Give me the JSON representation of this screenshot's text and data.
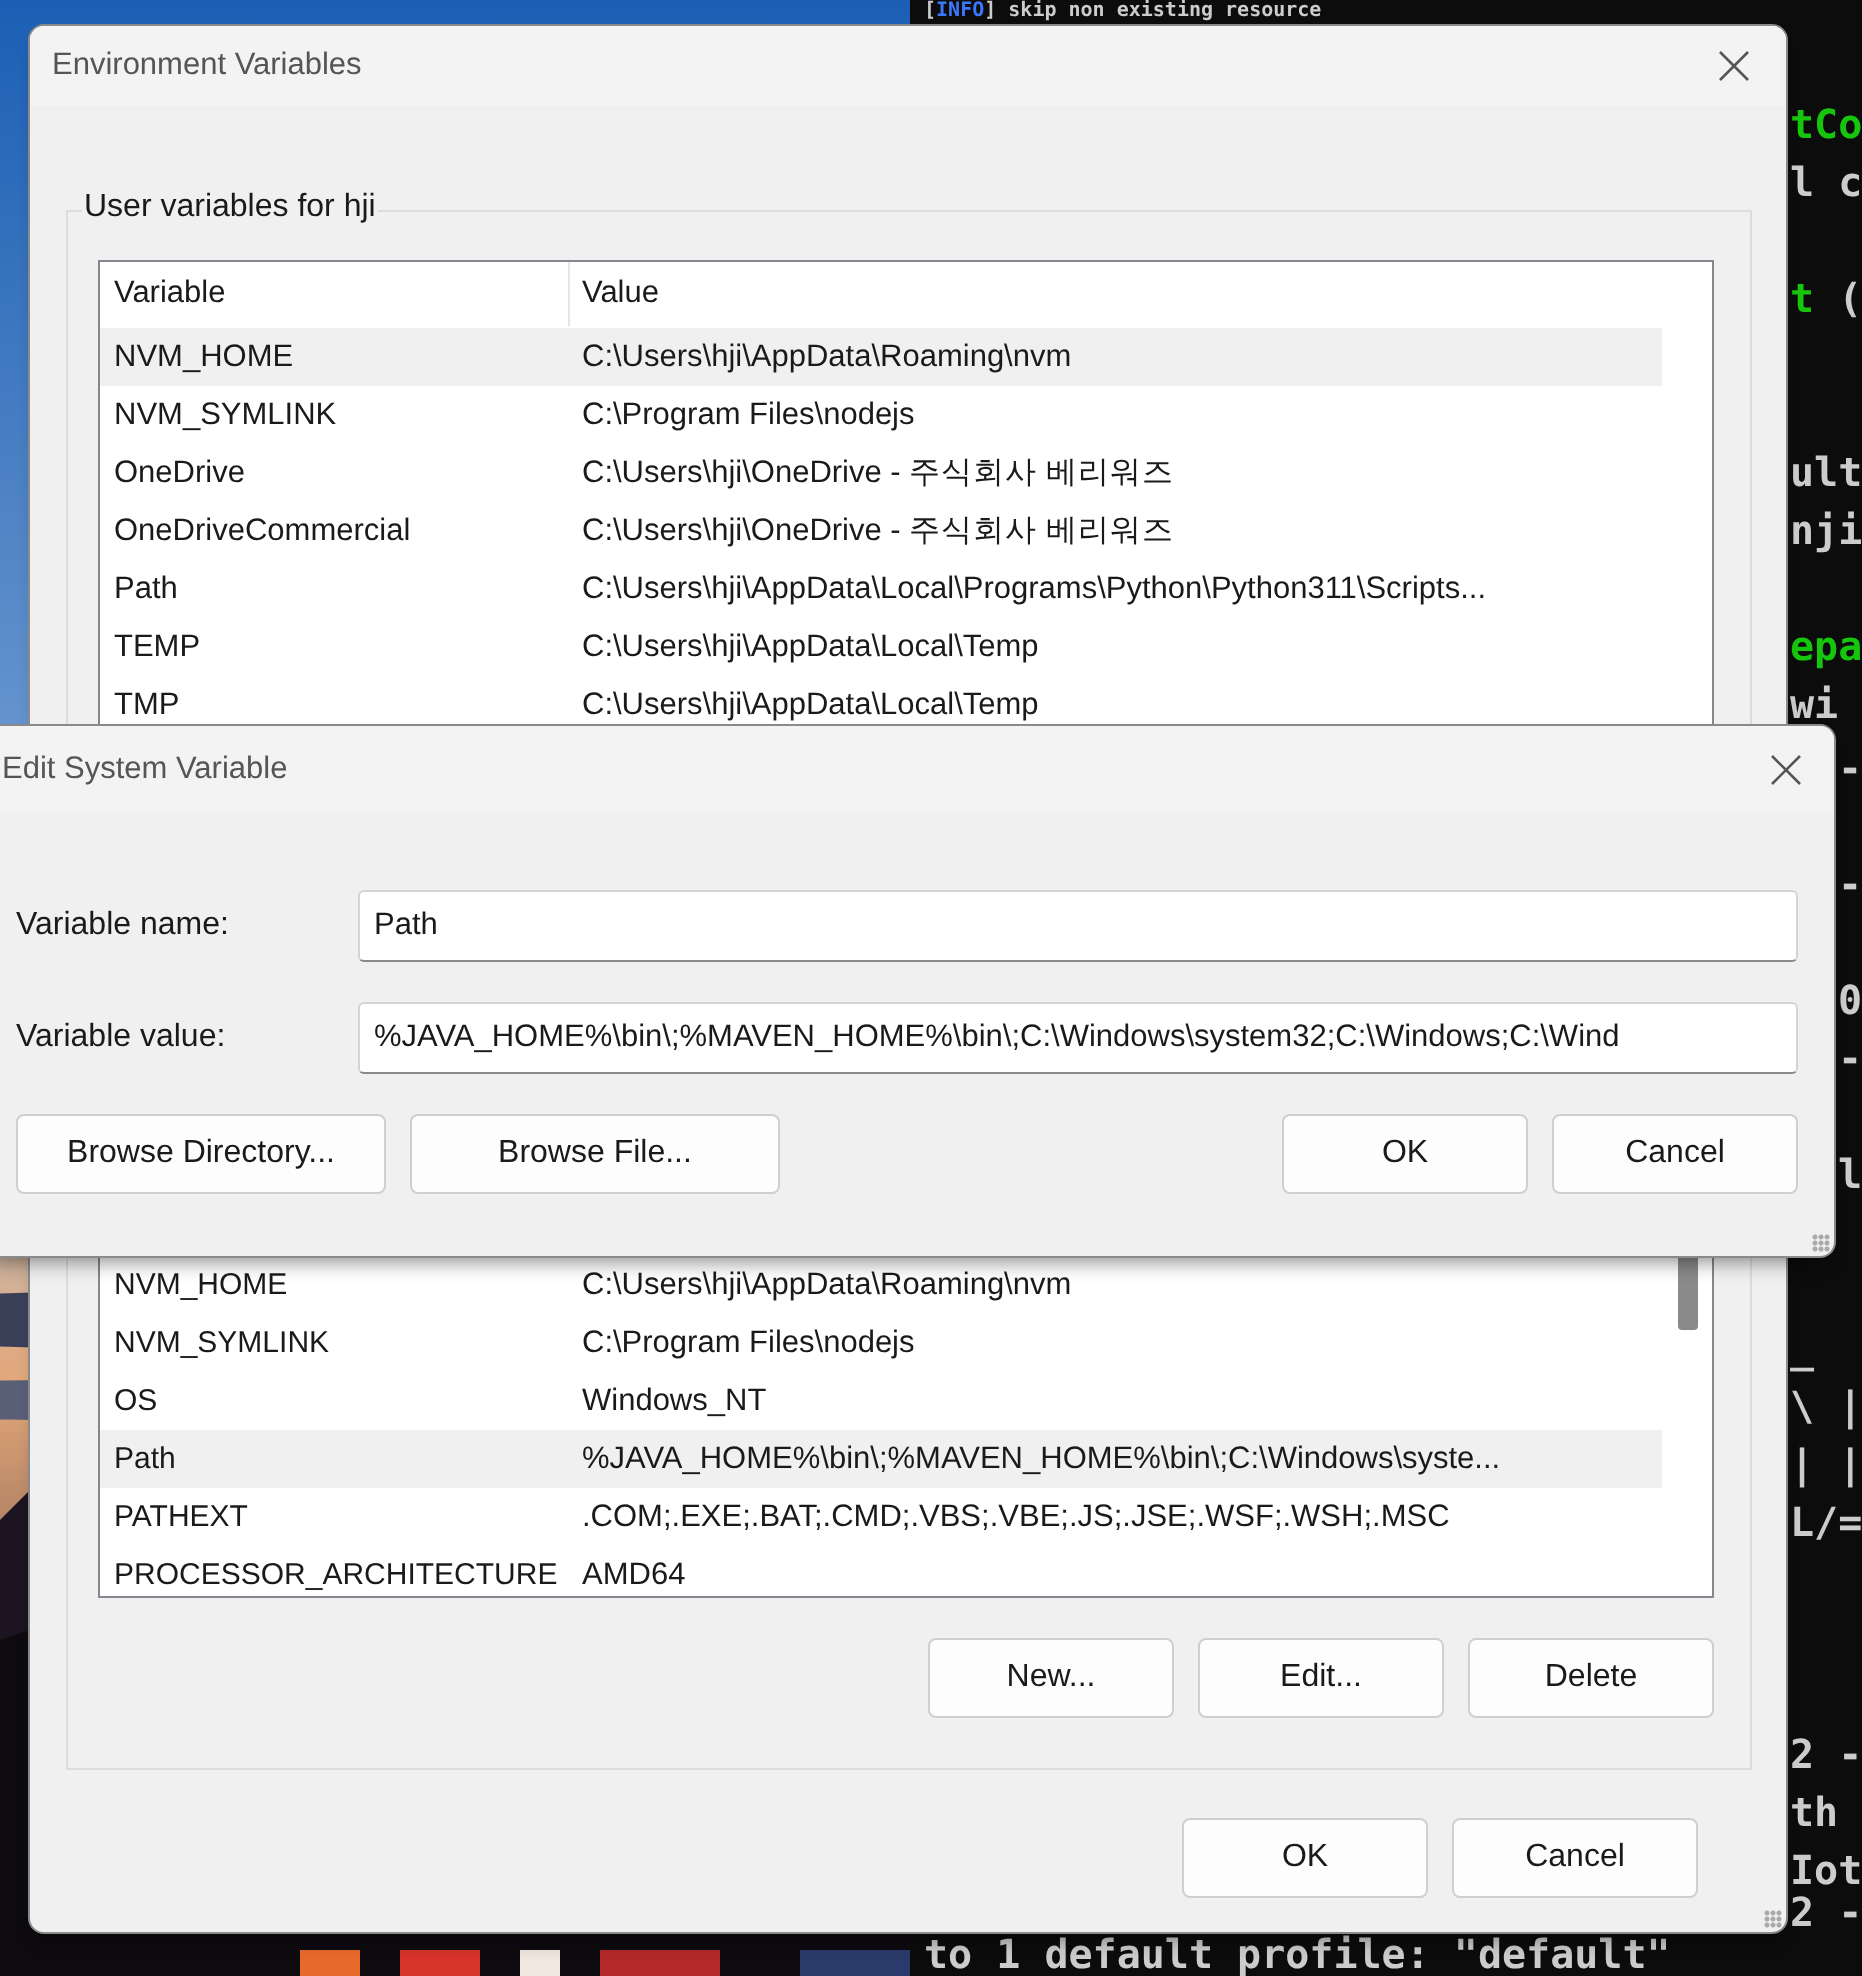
{
  "terminal": {
    "lines": [
      {
        "segments": [
          {
            "text": "[",
            "color": "#cccccc"
          },
          {
            "text": "INFO",
            "color": "#3b78ff"
          },
          {
            "text": "] skip non existing resource",
            "color": "#cccccc"
          }
        ]
      },
      {
        "segments": [
          {
            "text": "tCo",
            "color": "#16c60c"
          }
        ]
      },
      {
        "segments": [
          {
            "text": "l c",
            "color": "#cccccc"
          }
        ]
      },
      {
        "segments": [
          {
            "text": "t",
            "color": "#16c60c"
          },
          {
            "text": " (",
            "color": "#cccccc"
          }
        ]
      },
      {
        "segments": [
          {
            "text": "ult",
            "color": "#cccccc"
          }
        ]
      },
      {
        "segments": [
          {
            "text": "nji",
            "color": "#cccccc"
          }
        ]
      },
      {
        "segments": [
          {
            "text": "epa",
            "color": "#16c60c"
          }
        ]
      },
      {
        "segments": [
          {
            "text": "wi",
            "color": "#cccccc"
          }
        ]
      },
      {
        "segments": [
          {
            "text": "-",
            "color": "#cccccc"
          }
        ]
      },
      {
        "segments": [
          {
            "text": "-",
            "color": "#cccccc"
          }
        ]
      },
      {
        "segments": [
          {
            "text": "0",
            "color": "#cccccc"
          }
        ]
      },
      {
        "segments": [
          {
            "text": "-",
            "color": "#cccccc"
          }
        ]
      },
      {
        "segments": [
          {
            "text": "l",
            "color": "#cccccc"
          }
        ]
      },
      {
        "segments": [
          {
            "text": "_",
            "color": "#cccccc"
          }
        ]
      },
      {
        "segments": [
          {
            "text": "\\ |",
            "color": "#cccccc"
          }
        ]
      },
      {
        "segments": [
          {
            "text": "| |",
            "color": "#cccccc"
          }
        ]
      },
      {
        "segments": [
          {
            "text": "L/=",
            "color": "#cccccc"
          }
        ]
      },
      {
        "segments": [
          {
            "text": "2 -",
            "color": "#cccccc"
          }
        ]
      },
      {
        "segments": [
          {
            "text": "th",
            "color": "#cccccc"
          }
        ]
      },
      {
        "segments": [
          {
            "text": "Iot",
            "color": "#cccccc"
          }
        ]
      },
      {
        "segments": [
          {
            "text": "2 -",
            "color": "#cccccc"
          }
        ]
      },
      {
        "segments": [
          {
            "text": "to 1 default profile: \"default\"",
            "color": "#cccccc"
          }
        ]
      }
    ]
  },
  "env_window": {
    "title": "Environment Variables",
    "user_group": {
      "label": "User variables for hji",
      "columns": [
        "Variable",
        "Value"
      ],
      "rows": [
        {
          "variable": "NVM_HOME",
          "value": "C:\\Users\\hji\\AppData\\Roaming\\nvm",
          "selected": true
        },
        {
          "variable": "NVM_SYMLINK",
          "value": "C:\\Program Files\\nodejs",
          "selected": false
        },
        {
          "variable": "OneDrive",
          "value": "C:\\Users\\hji\\OneDrive - 주식회사 베리워즈",
          "selected": false
        },
        {
          "variable": "OneDriveCommercial",
          "value": "C:\\Users\\hji\\OneDrive - 주식회사 베리워즈",
          "selected": false
        },
        {
          "variable": "Path",
          "value": "C:\\Users\\hji\\AppData\\Local\\Programs\\Python\\Python311\\Scripts...",
          "selected": false
        },
        {
          "variable": "TEMP",
          "value": "C:\\Users\\hji\\AppData\\Local\\Temp",
          "selected": false
        },
        {
          "variable": "TMP",
          "value": "C:\\Users\\hji\\AppData\\Local\\Temp",
          "selected": false
        }
      ]
    },
    "system_group": {
      "rows": [
        {
          "variable": "NVM_HOME",
          "value": "C:\\Users\\hji\\AppData\\Roaming\\nvm",
          "selected": false
        },
        {
          "variable": "NVM_SYMLINK",
          "value": "C:\\Program Files\\nodejs",
          "selected": false
        },
        {
          "variable": "OS",
          "value": "Windows_NT",
          "selected": false
        },
        {
          "variable": "Path",
          "value": "%JAVA_HOME%\\bin\\;%MAVEN_HOME%\\bin\\;C:\\Windows\\syste...",
          "selected": true
        },
        {
          "variable": "PATHEXT",
          "value": ".COM;.EXE;.BAT;.CMD;.VBS;.VBE;.JS;.JSE;.WSF;.WSH;.MSC",
          "selected": false
        },
        {
          "variable": "PROCESSOR_ARCHITECTURE",
          "value": "AMD64",
          "selected": false
        }
      ],
      "buttons": [
        "New...",
        "Edit...",
        "Delete"
      ]
    },
    "buttons": [
      "OK",
      "Cancel"
    ]
  },
  "edit_dialog": {
    "title": "Edit System Variable",
    "fields": [
      {
        "label": "Variable name:",
        "value": "Path"
      },
      {
        "label": "Variable value:",
        "value": "%JAVA_HOME%\\bin\\;%MAVEN_HOME%\\bin\\;C:\\Windows\\system32;C:\\Windows;C:\\Wind"
      }
    ],
    "left_buttons": [
      "Browse Directory...",
      "Browse File..."
    ],
    "right_buttons": [
      "OK",
      "Cancel"
    ]
  }
}
